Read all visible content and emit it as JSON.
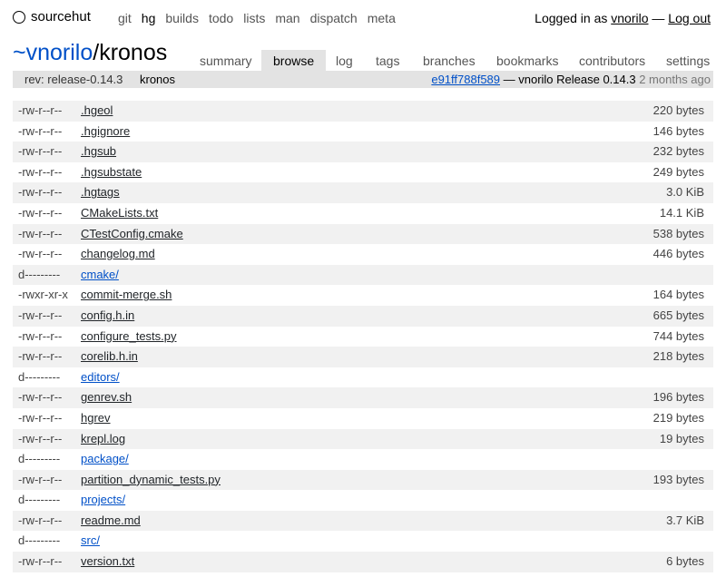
{
  "brand": {
    "name": "sourcehut"
  },
  "nav": {
    "links": [
      "git",
      "hg",
      "builds",
      "todo",
      "lists",
      "man",
      "dispatch",
      "meta"
    ],
    "active": "hg"
  },
  "auth": {
    "prefix": "Logged in as",
    "user": "vnorilo",
    "separator": "—",
    "logout": "Log out"
  },
  "repo": {
    "owner": "~vnorilo",
    "sep": "/",
    "name": "kronos"
  },
  "tabs": [
    "summary",
    "browse",
    "log",
    "tags",
    "branches",
    "bookmarks",
    "contributors",
    "settings"
  ],
  "active_tab": "browse",
  "rev": {
    "label": "rev: release-0.14.3",
    "name": "kronos",
    "hash": "e91ff788f589",
    "message": " — vnorilo Release 0.14.3 ",
    "ago": "2 months ago"
  },
  "files": [
    {
      "mode": "-rw-r--r--",
      "name": ".hgeol",
      "size": "220 bytes",
      "dir": false
    },
    {
      "mode": "-rw-r--r--",
      "name": ".hgignore",
      "size": "146 bytes",
      "dir": false
    },
    {
      "mode": "-rw-r--r--",
      "name": ".hgsub",
      "size": "232 bytes",
      "dir": false
    },
    {
      "mode": "-rw-r--r--",
      "name": ".hgsubstate",
      "size": "249 bytes",
      "dir": false
    },
    {
      "mode": "-rw-r--r--",
      "name": ".hgtags",
      "size": "3.0 KiB",
      "dir": false
    },
    {
      "mode": "-rw-r--r--",
      "name": "CMakeLists.txt",
      "size": "14.1 KiB",
      "dir": false
    },
    {
      "mode": "-rw-r--r--",
      "name": "CTestConfig.cmake",
      "size": "538 bytes",
      "dir": false
    },
    {
      "mode": "-rw-r--r--",
      "name": "changelog.md",
      "size": "446 bytes",
      "dir": false
    },
    {
      "mode": "d---------",
      "name": "cmake/",
      "size": "",
      "dir": true
    },
    {
      "mode": "-rwxr-xr-x",
      "name": "commit-merge.sh",
      "size": "164 bytes",
      "dir": false
    },
    {
      "mode": "-rw-r--r--",
      "name": "config.h.in",
      "size": "665 bytes",
      "dir": false
    },
    {
      "mode": "-rw-r--r--",
      "name": "configure_tests.py",
      "size": "744 bytes",
      "dir": false
    },
    {
      "mode": "-rw-r--r--",
      "name": "corelib.h.in",
      "size": "218 bytes",
      "dir": false
    },
    {
      "mode": "d---------",
      "name": "editors/",
      "size": "",
      "dir": true
    },
    {
      "mode": "-rw-r--r--",
      "name": "genrev.sh",
      "size": "196 bytes",
      "dir": false
    },
    {
      "mode": "-rw-r--r--",
      "name": "hgrev",
      "size": "219 bytes",
      "dir": false
    },
    {
      "mode": "-rw-r--r--",
      "name": "krepl.log",
      "size": "19 bytes",
      "dir": false
    },
    {
      "mode": "d---------",
      "name": "package/",
      "size": "",
      "dir": true
    },
    {
      "mode": "-rw-r--r--",
      "name": "partition_dynamic_tests.py",
      "size": "193 bytes",
      "dir": false
    },
    {
      "mode": "d---------",
      "name": "projects/",
      "size": "",
      "dir": true
    },
    {
      "mode": "-rw-r--r--",
      "name": "readme.md",
      "size": "3.7 KiB",
      "dir": false
    },
    {
      "mode": "d---------",
      "name": "src/",
      "size": "",
      "dir": true
    },
    {
      "mode": "-rw-r--r--",
      "name": "version.txt",
      "size": "6 bytes",
      "dir": false
    }
  ],
  "colors": {
    "link_blue": "#0050c8",
    "bar_gray": "#e3e3e3",
    "stripe": "#f1f1f1"
  }
}
